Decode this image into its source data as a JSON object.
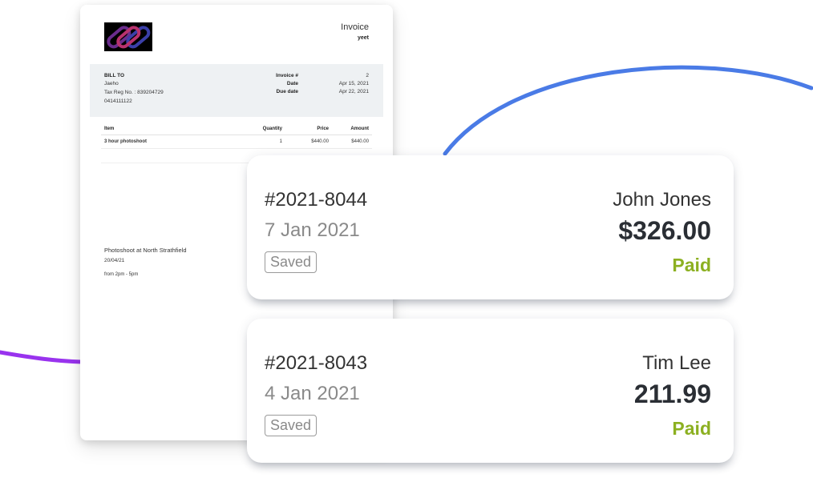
{
  "colors": {
    "arc_blue": "#4a7be6",
    "arc_purple": "#9933ee",
    "paid": "#8cb021",
    "muted": "#8a8a8a"
  },
  "invoice": {
    "title": "Invoice",
    "subtitle": "yeet",
    "bill_to": {
      "heading": "BILL TO",
      "name": "Jaeho",
      "tax_reg": "Tax Reg No. : 839204729",
      "phone": "0414111122"
    },
    "meta": [
      {
        "label": "Invoice #",
        "value": "2"
      },
      {
        "label": "Date",
        "value": "Apr 15, 2021"
      },
      {
        "label": "Due date",
        "value": "Apr 22, 2021"
      }
    ],
    "columns": {
      "item": "Item",
      "quantity": "Quantity",
      "price": "Price",
      "amount": "Amount"
    },
    "items": [
      {
        "item": "3 hour photoshoot",
        "quantity": "1",
        "price": "$440.00",
        "amount": "$440.00"
      }
    ],
    "notes": {
      "line1": "Photoshoot at North Strathfield",
      "line2": "20/04/21",
      "line3": "from 2pm - 5pm"
    }
  },
  "cards": [
    {
      "number": "#2021-8044",
      "date": "7 Jan 2021",
      "badge": "Saved",
      "client": "John Jones",
      "amount": "$326.00",
      "status": "Paid"
    },
    {
      "number": "#2021-8043",
      "date": "4 Jan 2021",
      "badge": "Saved",
      "client": "Tim Lee",
      "amount": "211.99",
      "status": "Paid"
    }
  ]
}
